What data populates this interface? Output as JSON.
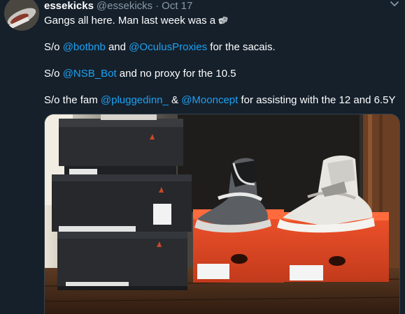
{
  "tweet": {
    "author_name": "essekicks",
    "author_handle": "@essekicks",
    "separator": "·",
    "date": "Oct 17",
    "lines": {
      "l1": "Gangs all here. Man last week was a",
      "l2_a": "S/o ",
      "l2_m1": "@botbnb",
      "l2_b": " and ",
      "l2_m2": "@OculusProxies",
      "l2_c": " for the sacais.",
      "l3_a": "S/o ",
      "l3_m1": "@NSB_Bot",
      "l3_b": " and no proxy for the 10.5",
      "l4_a": "S/o the fam ",
      "l4_m1": "@pluggedinn_",
      "l4_b": " & ",
      "l4_m2": "@Mooncept",
      "l4_c": " for assisting with the 12 and 6.5Y"
    },
    "emoji_icon": "dice-emoji",
    "menu_icon": "chevron-down-icon"
  },
  "colors": {
    "background": "#15202b",
    "text": "#ffffff",
    "secondary": "#8899a6",
    "link": "#1da1f2"
  }
}
